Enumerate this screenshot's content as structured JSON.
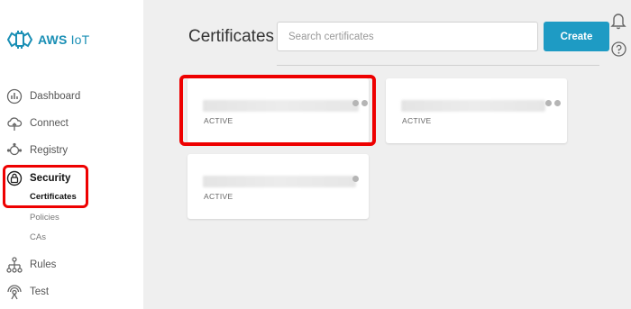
{
  "brand": {
    "name_bold": "AWS",
    "name_light": "IoT",
    "icon": "aws-iot-logo-icon"
  },
  "nav": {
    "items": [
      {
        "label": "Dashboard",
        "icon": "dashboard-icon"
      },
      {
        "label": "Connect",
        "icon": "cloud-icon"
      },
      {
        "label": "Registry",
        "icon": "registry-icon"
      },
      {
        "label": "Security",
        "icon": "lock-icon",
        "active": true
      },
      {
        "label": "Rules",
        "icon": "rules-icon"
      },
      {
        "label": "Test",
        "icon": "test-icon"
      }
    ],
    "security_sub": [
      {
        "label": "Certificates",
        "active": true
      },
      {
        "label": "Policies"
      },
      {
        "label": "CAs"
      }
    ]
  },
  "header": {
    "title": "Certificates",
    "search_placeholder": "Search certificates",
    "create_label": "Create",
    "icons": [
      "bell-icon",
      "help-icon"
    ]
  },
  "certificates": [
    {
      "status": "ACTIVE"
    },
    {
      "status": "ACTIVE"
    },
    {
      "status": "ACTIVE"
    }
  ],
  "colors": {
    "accent": "#1e9bc4",
    "highlight": "#ee0000",
    "brand": "#1a8fb5"
  }
}
